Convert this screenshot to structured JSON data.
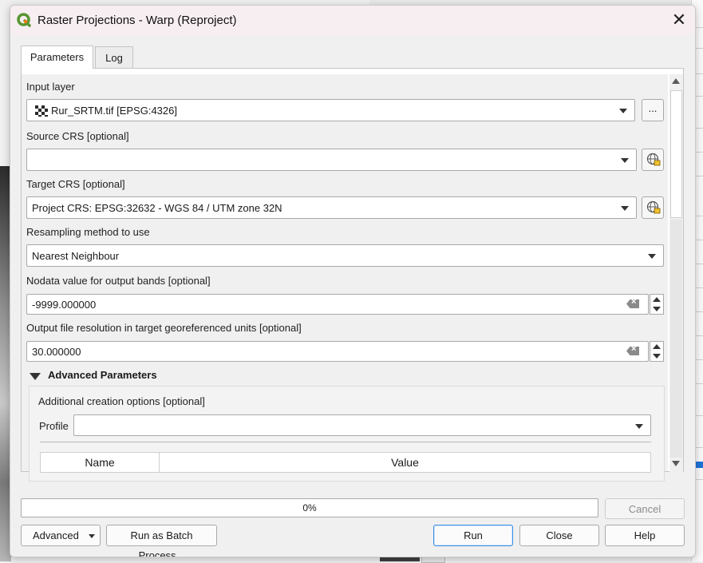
{
  "window": {
    "title": "Raster Projections - Warp (Reproject)",
    "close_glyph": "✕"
  },
  "tabs": [
    {
      "label": "Parameters",
      "active": true
    },
    {
      "label": "Log",
      "active": false
    }
  ],
  "params": {
    "input_layer": {
      "label": "Input layer",
      "value": "Rur_SRTM.tif [EPSG:4326]",
      "browse_label": "..."
    },
    "source_crs": {
      "label": "Source CRS [optional]",
      "value": ""
    },
    "target_crs": {
      "label": "Target CRS [optional]",
      "value": "Project CRS: EPSG:32632 - WGS 84 / UTM zone 32N"
    },
    "resampling": {
      "label": "Resampling method to use",
      "value": "Nearest Neighbour"
    },
    "nodata": {
      "label": "Nodata value for output bands [optional]",
      "value": "-9999.000000"
    },
    "resolution": {
      "label": "Output file resolution in target georeferenced units [optional]",
      "value": "30.000000"
    }
  },
  "advanced": {
    "header": "Advanced Parameters",
    "creation_options_label": "Additional creation options [optional]",
    "profile_label": "Profile",
    "profile_value": "",
    "table_columns": [
      "Name",
      "Value"
    ]
  },
  "footer": {
    "progress_text": "0%",
    "progress_value": 0,
    "cancel_label": "Cancel",
    "advanced_label": "Advanced",
    "batch_label": "Run as Batch Process...",
    "run_label": "Run",
    "close_label": "Close",
    "help_label": "Help"
  },
  "colors": {
    "titlebar_bg": "#f7eef2",
    "qgis_green": "#589632",
    "qgis_yellow": "#ee7913",
    "default_button_border": "#3a8ee6"
  }
}
